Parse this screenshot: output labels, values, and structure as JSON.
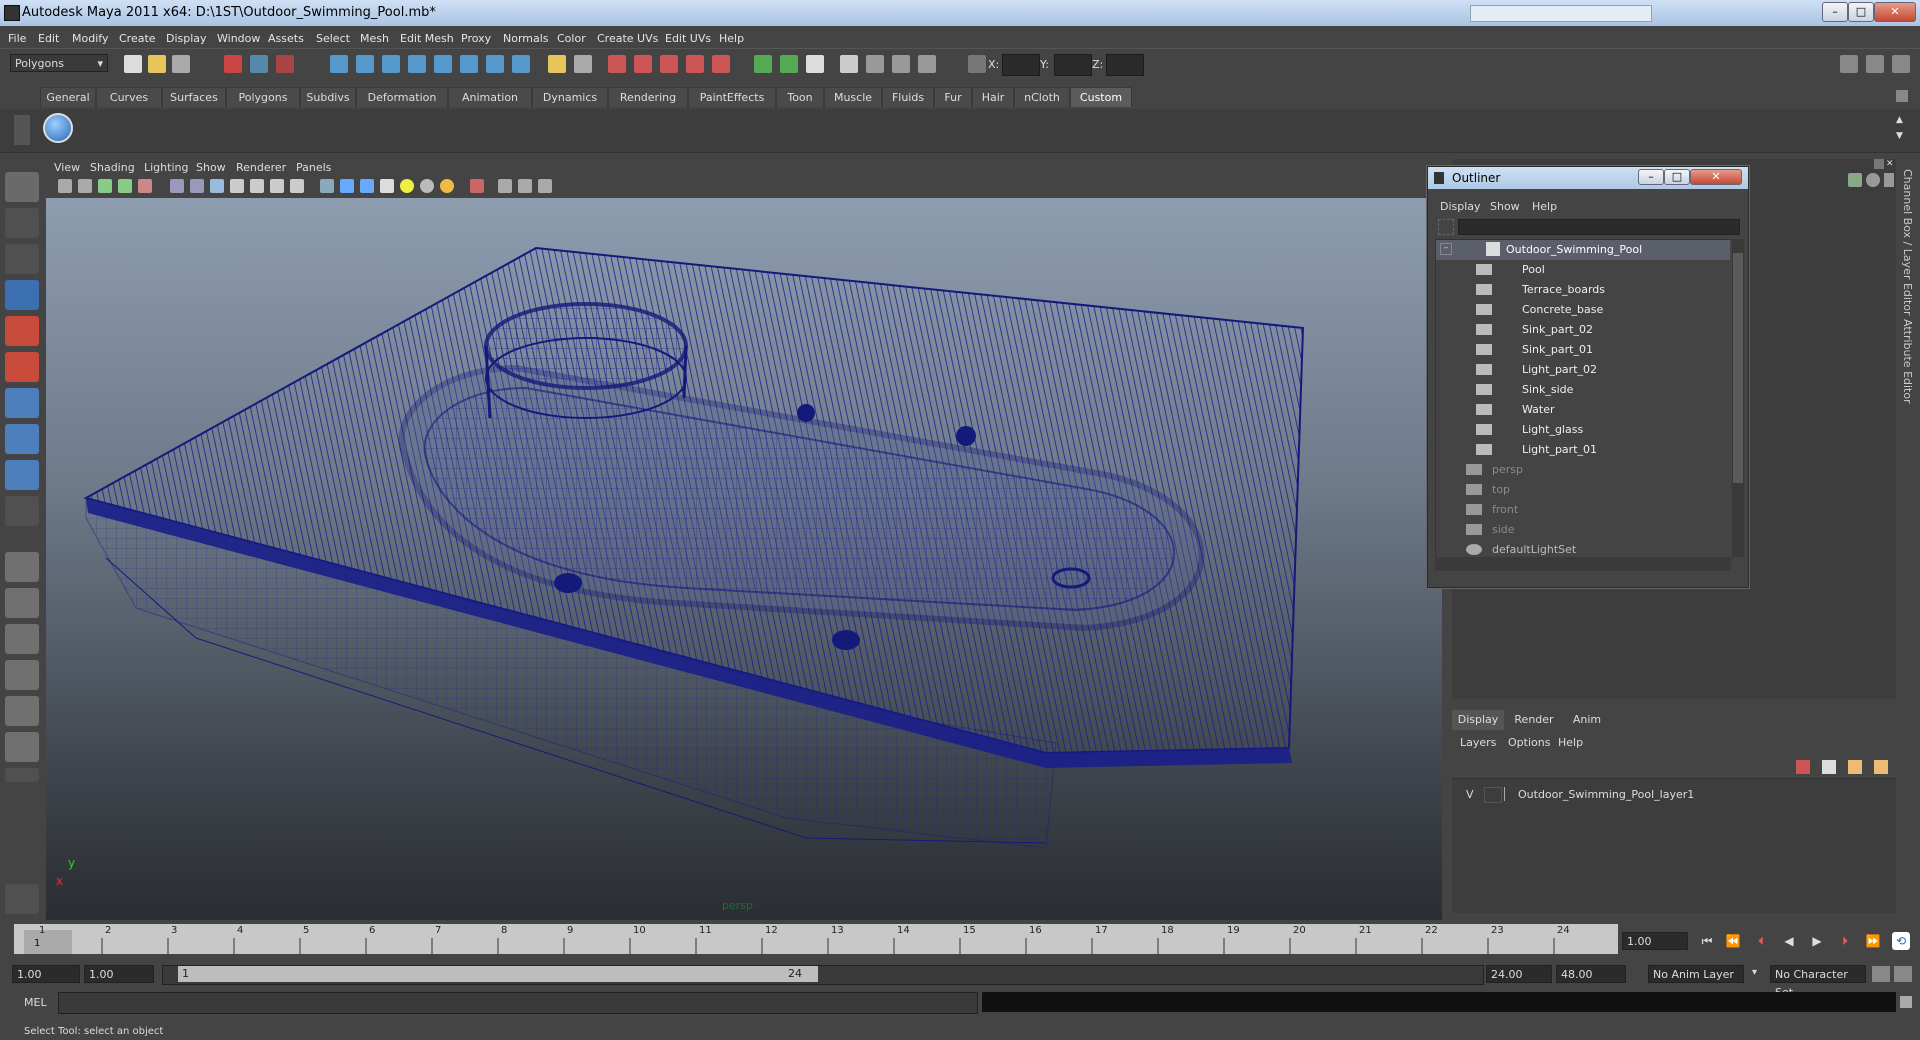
{
  "window": {
    "title": "Autodesk Maya 2011 x64: D:\\1ST\\Outdoor_Swimming_Pool.mb*"
  },
  "menubar": [
    "File",
    "Edit",
    "Modify",
    "Create",
    "Display",
    "Window",
    "Assets",
    "Select",
    "Mesh",
    "Edit Mesh",
    "Proxy",
    "Normals",
    "Color",
    "Create UVs",
    "Edit UVs",
    "Help"
  ],
  "toolbar": {
    "mode": "Polygons",
    "x_label": "X:",
    "y_label": "Y:",
    "z_label": "Z:"
  },
  "shelf_tabs": [
    "General",
    "Curves",
    "Surfaces",
    "Polygons",
    "Subdivs",
    "Deformation",
    "Animation",
    "Dynamics",
    "Rendering",
    "PaintEffects",
    "Toon",
    "Muscle",
    "Fluids",
    "Fur",
    "Hair",
    "nCloth",
    "Custom"
  ],
  "shelf_selected": "Custom",
  "viewport": {
    "menus": [
      "View",
      "Shading",
      "Lighting",
      "Show",
      "Renderer",
      "Panels"
    ],
    "camera_label": "persp",
    "axis_x": "x",
    "axis_y": "y"
  },
  "outliner": {
    "title": "Outliner",
    "menus": [
      "Display",
      "Show",
      "Help"
    ],
    "root": "Outdoor_Swimming_Pool",
    "children": [
      "Pool",
      "Terrace_boards",
      "Concrete_base",
      "Sink_part_02",
      "Sink_part_01",
      "Light_part_02",
      "Sink_side",
      "Water",
      "Light_glass",
      "Light_part_01"
    ],
    "cameras": [
      "persp",
      "top",
      "front",
      "side"
    ],
    "sets": [
      "defaultLightSet"
    ]
  },
  "right_strip": {
    "channel_box": "Channel Box / Layer Editor",
    "attr_editor": "Attribute Editor"
  },
  "layer_editor": {
    "tabs": [
      "Display",
      "Render",
      "Anim"
    ],
    "selected_tab": "Display",
    "menus": [
      "Layers",
      "Options",
      "Help"
    ],
    "layer_visible": "V",
    "layer_name": "Outdoor_Swimming_Pool_layer1"
  },
  "timeline": {
    "ticks": [
      "1",
      "2",
      "3",
      "4",
      "5",
      "6",
      "7",
      "8",
      "9",
      "10",
      "11",
      "12",
      "13",
      "14",
      "15",
      "16",
      "17",
      "18",
      "19",
      "20",
      "21",
      "22",
      "23",
      "24"
    ],
    "current_frame_marker": "1",
    "current_frame": "1.00"
  },
  "range": {
    "start_time": "1.00",
    "start_range": "1.00",
    "slider_start": "1",
    "slider_end": "24",
    "end_range": "24.00",
    "end_time": "48.00",
    "anim_layer": "No Anim Layer",
    "char_set": "No Character Set"
  },
  "command": {
    "label": "MEL",
    "status": "Select Tool: select an object"
  }
}
